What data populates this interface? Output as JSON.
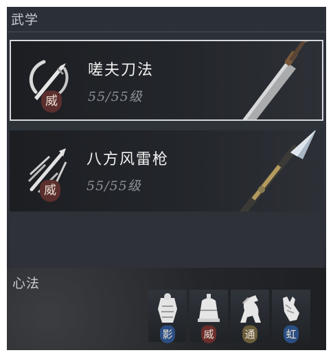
{
  "martial": {
    "title": "武学",
    "skills": [
      {
        "name": "嗟夫刀法",
        "level": "55/55级",
        "seal": "威",
        "selected": true
      },
      {
        "name": "八方风雷枪",
        "level": "55/55级",
        "seal": "威",
        "selected": false
      }
    ]
  },
  "xinfa": {
    "title": "心法",
    "slots": [
      {
        "icon": "armor-figure-icon",
        "seal": "影",
        "seal_color": "#2c4f83"
      },
      {
        "icon": "bell-icon",
        "seal": "威",
        "seal_color": "#6b2e2b"
      },
      {
        "icon": "horse-icon",
        "seal": "通",
        "seal_color": "#6a5d3a"
      },
      {
        "icon": "glove-icon",
        "seal": "虹",
        "seal_color": "#2c4f83"
      }
    ]
  }
}
